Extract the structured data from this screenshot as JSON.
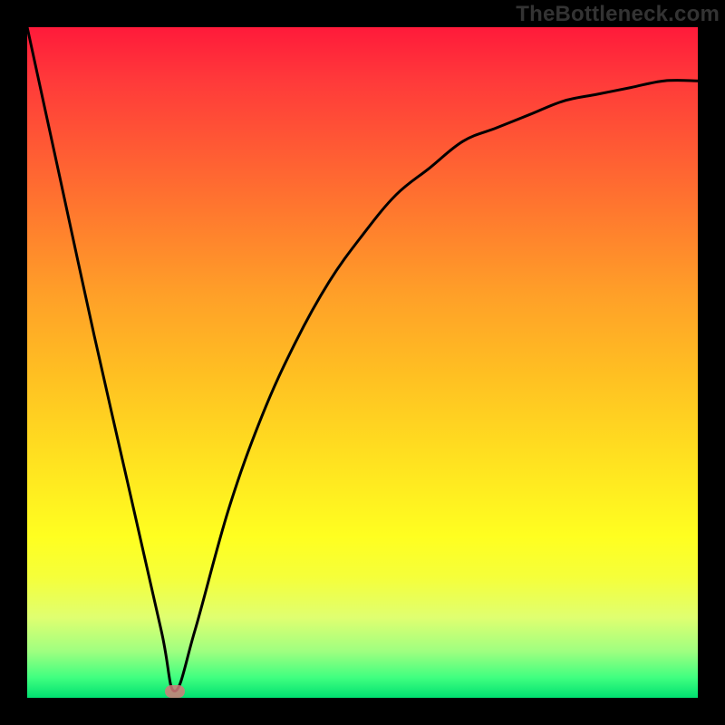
{
  "attribution": "TheBottleneck.com",
  "colors": {
    "frame": "#000000",
    "gradient_top": "#ff1a3a",
    "gradient_bottom": "#00e070",
    "curve": "#000000",
    "marker": "#d47a7a"
  },
  "chart_data": {
    "type": "line",
    "title": "",
    "xlabel": "",
    "ylabel": "",
    "xlim": [
      0,
      100
    ],
    "ylim": [
      0,
      100
    ],
    "grid": false,
    "legend": false,
    "marker": {
      "x": 22,
      "y": 1
    },
    "series": [
      {
        "name": "bottleneck-curve",
        "x": [
          0,
          5,
          10,
          15,
          20,
          22,
          25,
          30,
          35,
          40,
          45,
          50,
          55,
          60,
          65,
          70,
          75,
          80,
          85,
          90,
          95,
          100
        ],
        "values": [
          100,
          77,
          54,
          32,
          10,
          1,
          10,
          28,
          42,
          53,
          62,
          69,
          75,
          79,
          83,
          85,
          87,
          89,
          90,
          91,
          92,
          92
        ]
      }
    ]
  }
}
